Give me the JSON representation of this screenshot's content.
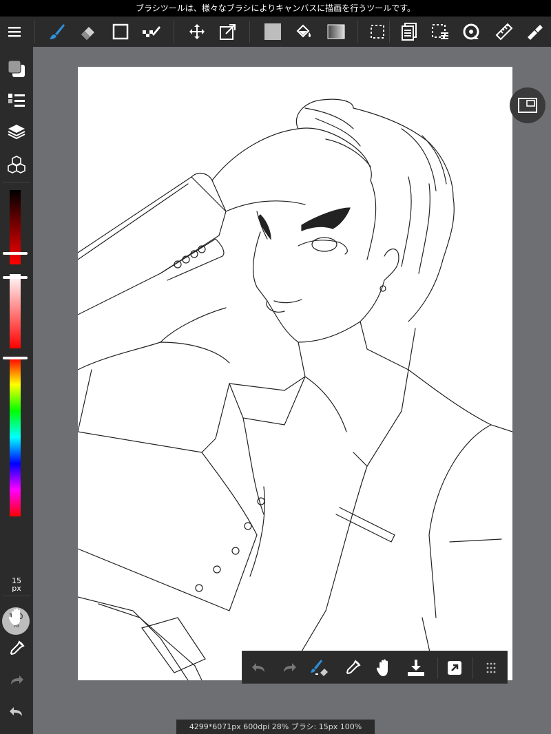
{
  "tooltip": {
    "text": "ブラシツールは、様々なブラシによりキャンバスに描画を行うツールです。"
  },
  "toolbar": {
    "tools": [
      {
        "name": "menu-icon"
      },
      {
        "name": "brush-tool-icon",
        "active": true
      },
      {
        "name": "eraser-tool-icon"
      },
      {
        "name": "rectangle-tool-icon"
      },
      {
        "name": "dot-tool-icon"
      },
      {
        "name": "move-tool-icon"
      },
      {
        "name": "transform-tool-icon"
      },
      {
        "name": "fill-color-icon"
      },
      {
        "name": "bucket-tool-icon"
      },
      {
        "name": "gradient-tool-icon"
      },
      {
        "name": "select-tool-icon"
      },
      {
        "name": "layer-copy-icon"
      },
      {
        "name": "selection-menu-icon"
      },
      {
        "name": "rotate-icon"
      },
      {
        "name": "ruler-icon"
      },
      {
        "name": "pen-settings-icon"
      }
    ]
  },
  "sidebar": {
    "brush_size": {
      "value": "15",
      "unit": "px"
    },
    "opacity": {
      "value": "100",
      "unit": "%"
    },
    "color_sliders": {
      "brightness_level": 0.85,
      "saturation_level": 0.05,
      "hue_level": 0.0
    }
  },
  "quickbar": {
    "items": [
      {
        "name": "undo-icon"
      },
      {
        "name": "redo-icon"
      },
      {
        "name": "brush-eraser-toggle-icon",
        "active": true
      },
      {
        "name": "eyedropper-icon"
      },
      {
        "name": "hand-icon"
      },
      {
        "name": "save-icon"
      },
      {
        "name": "share-icon"
      },
      {
        "name": "more-icon"
      }
    ]
  },
  "status": {
    "text": "4299*6071px 600dpi 28% ブラシ: 15px 100%"
  },
  "colors": {
    "accent": "#2f8fd8",
    "panel": "#2b2b2b",
    "workspace": "#6d6f73"
  }
}
